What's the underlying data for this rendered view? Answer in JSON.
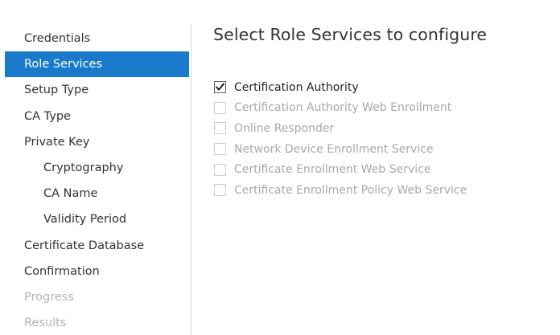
{
  "nav": {
    "items": [
      {
        "label": "Credentials",
        "state": "normal",
        "level": 0
      },
      {
        "label": "Role Services",
        "state": "active",
        "level": 0
      },
      {
        "label": "Setup Type",
        "state": "normal",
        "level": 0
      },
      {
        "label": "CA Type",
        "state": "normal",
        "level": 0
      },
      {
        "label": "Private Key",
        "state": "normal",
        "level": 0
      },
      {
        "label": "Cryptography",
        "state": "normal",
        "level": 1
      },
      {
        "label": "CA Name",
        "state": "normal",
        "level": 1
      },
      {
        "label": "Validity Period",
        "state": "normal",
        "level": 1
      },
      {
        "label": "Certificate Database",
        "state": "normal",
        "level": 0
      },
      {
        "label": "Confirmation",
        "state": "normal",
        "level": 0
      },
      {
        "label": "Progress",
        "state": "disabled",
        "level": 0
      },
      {
        "label": "Results",
        "state": "disabled",
        "level": 0
      }
    ]
  },
  "main": {
    "title": "Select Role Services to configure",
    "services": [
      {
        "label": "Certification Authority",
        "checked": true,
        "enabled": true
      },
      {
        "label": "Certification Authority Web Enrollment",
        "checked": false,
        "enabled": false
      },
      {
        "label": "Online Responder",
        "checked": false,
        "enabled": false
      },
      {
        "label": "Network Device Enrollment Service",
        "checked": false,
        "enabled": false
      },
      {
        "label": "Certificate Enrollment Web Service",
        "checked": false,
        "enabled": false
      },
      {
        "label": "Certificate Enrollment Policy Web Service",
        "checked": false,
        "enabled": false
      }
    ]
  },
  "icons": {
    "checkmark": "check-icon"
  },
  "colors": {
    "active_nav_bg": "#1979ca",
    "active_nav_text": "#ffffff",
    "text": "#333333",
    "disabled_text": "#b4b4b4"
  }
}
